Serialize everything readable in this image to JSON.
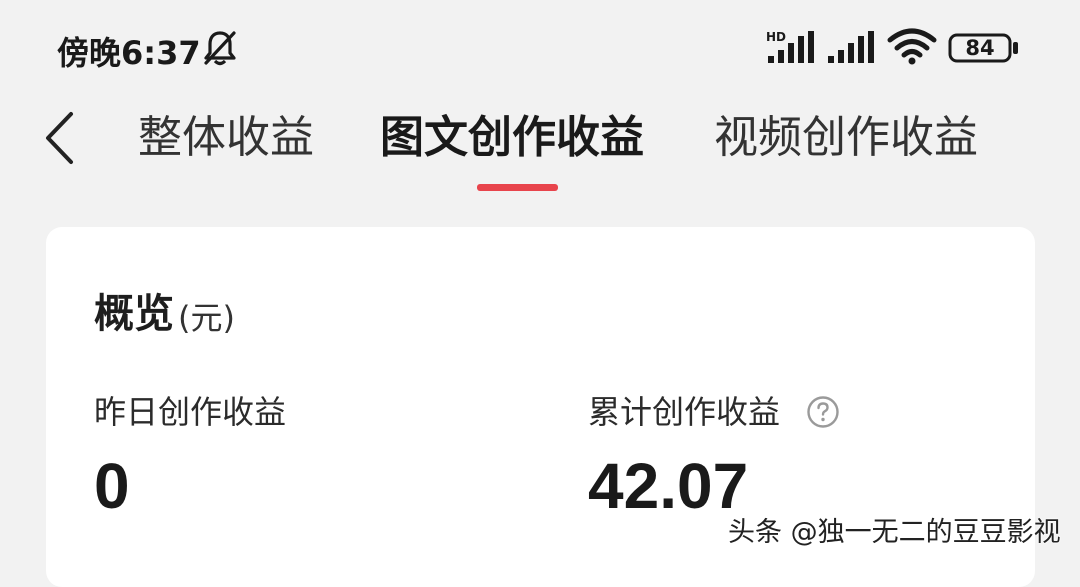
{
  "status_bar": {
    "time": "傍晚6:37",
    "network_label": "HD",
    "battery_level": "84",
    "icons": [
      "bell-muted-icon",
      "signal-hd-icon",
      "signal-icon",
      "wifi-icon",
      "battery-icon"
    ]
  },
  "nav": {
    "back_icon": "chevron-left-icon",
    "tabs": [
      {
        "label": "整体收益",
        "active": false
      },
      {
        "label": "图文创作收益",
        "active": true
      },
      {
        "label": "视频创作收益",
        "active": false
      }
    ],
    "accent_color": "#e8444c"
  },
  "overview": {
    "title": "概览",
    "unit": "(元)",
    "metrics": [
      {
        "label": "昨日创作收益",
        "value": "0"
      },
      {
        "label": "累计创作收益",
        "value": "42.07",
        "help_icon": "question-circle-icon"
      }
    ]
  },
  "watermark": "头条 @独一无二的豆豆影视"
}
